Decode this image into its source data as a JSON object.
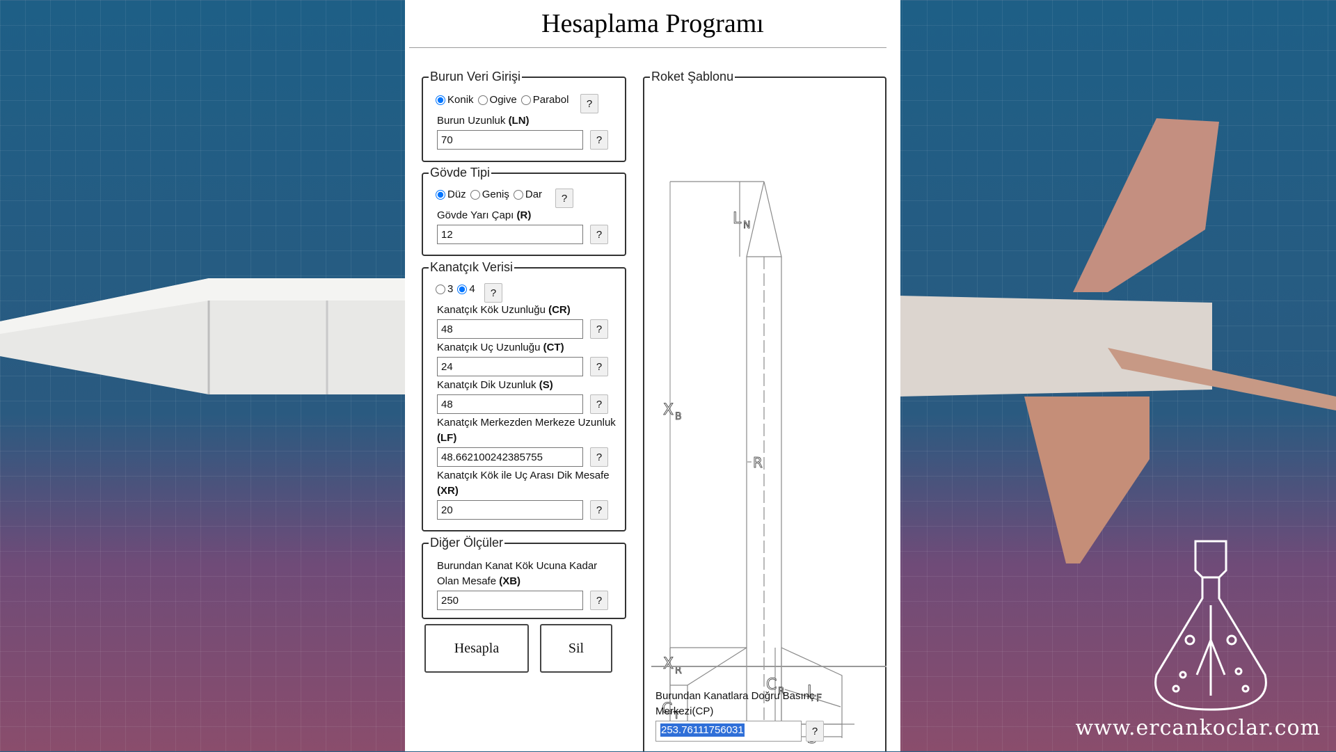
{
  "page": {
    "title": "Hesaplama Programı",
    "watermark": "www.ercankoclar.com"
  },
  "nose": {
    "legend": "Burun Veri Girişi",
    "options": [
      "Konik",
      "Ogive",
      "Parabol"
    ],
    "selected": "Konik",
    "length_label": "Burun Uzunluk",
    "length_abbr": "(LN)",
    "length_value": "70",
    "help": "?"
  },
  "body": {
    "legend": "Gövde Tipi",
    "options": [
      "Düz",
      "Geniş",
      "Dar"
    ],
    "selected": "Düz",
    "radius_label": "Gövde Yarı Çapı",
    "radius_abbr": "(R)",
    "radius_value": "12",
    "help": "?"
  },
  "fins": {
    "legend": "Kanatçık Verisi",
    "options": [
      "3",
      "4"
    ],
    "selected": "4",
    "help": "?",
    "fields": [
      {
        "label": "Kanatçık Kök Uzunluğu",
        "abbr": "(CR)",
        "value": "48"
      },
      {
        "label": "Kanatçık Uç Uzunluğu",
        "abbr": "(CT)",
        "value": "24"
      },
      {
        "label": "Kanatçık Dik Uzunluk",
        "abbr": "(S)",
        "value": "48"
      },
      {
        "label": "Kanatçık Merkezden Merkeze Uzunluk",
        "abbr": "(LF)",
        "value": "48.662100242385755"
      },
      {
        "label": "Kanatçık Kök ile Uç Arası Dik Mesafe",
        "abbr": "(XR)",
        "value": "20"
      }
    ]
  },
  "other": {
    "legend": "Diğer Ölçüler",
    "xb_label": "Burundan Kanat Kök Ucuna Kadar Olan Mesafe",
    "xb_abbr": "(XB)",
    "xb_value": "250",
    "help": "?"
  },
  "actions": {
    "calculate": "Hesapla",
    "clear": "Sil"
  },
  "template": {
    "legend": "Roket Şablonu",
    "labels": {
      "ln": "L",
      "ln_sub": "N",
      "xb": "X",
      "xb_sub": "B",
      "r": "R",
      "xr": "X",
      "xr_sub": "R",
      "ct": "C",
      "ct_sub": "T",
      "cr": "C",
      "cr_sub": "R",
      "lf": "L",
      "lf_sub": "F",
      "s": "S"
    }
  },
  "result": {
    "label": "Burundan Kanatlara Doğru Basınç Merkezi",
    "abbr": "(CP)",
    "value": "253.76111756031",
    "help": "?"
  }
}
